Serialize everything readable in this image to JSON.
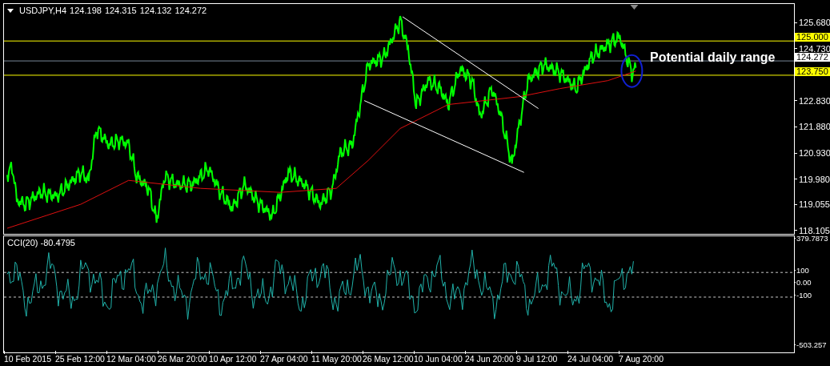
{
  "header": {
    "title": "USDJPY,H4",
    "ohlc": [
      "124.198",
      "124.315",
      "124.132",
      "124.272"
    ]
  },
  "price_axis": {
    "ticks": [
      "125.680",
      "124.730",
      "122.830",
      "121.880",
      "120.930",
      "119.980",
      "119.055",
      "118.105"
    ],
    "levels": [
      {
        "label": "125.000",
        "kind": "level"
      },
      {
        "label": "124.272",
        "kind": "bid"
      },
      {
        "label": "123.750",
        "kind": "level"
      }
    ]
  },
  "annotation": "Potential daily range",
  "indicator": {
    "title": "CCI(20) -80.4795",
    "axis_labels": [
      "379.7873",
      "100",
      "0.00",
      "-100",
      "-503.257"
    ]
  },
  "time_axis": [
    "10 Feb 2015",
    "25 Feb 12:00",
    "12 Mar 04:00",
    "26 Mar 20:00",
    "10 Apr 12:00",
    "27 Apr 04:00",
    "11 May 20:00",
    "26 May 12:00",
    "10 Jun 04:00",
    "24 Jun 20:00",
    "9 Jul 12:00",
    "24 Jul 04:00",
    "7 Aug 20:00"
  ]
}
